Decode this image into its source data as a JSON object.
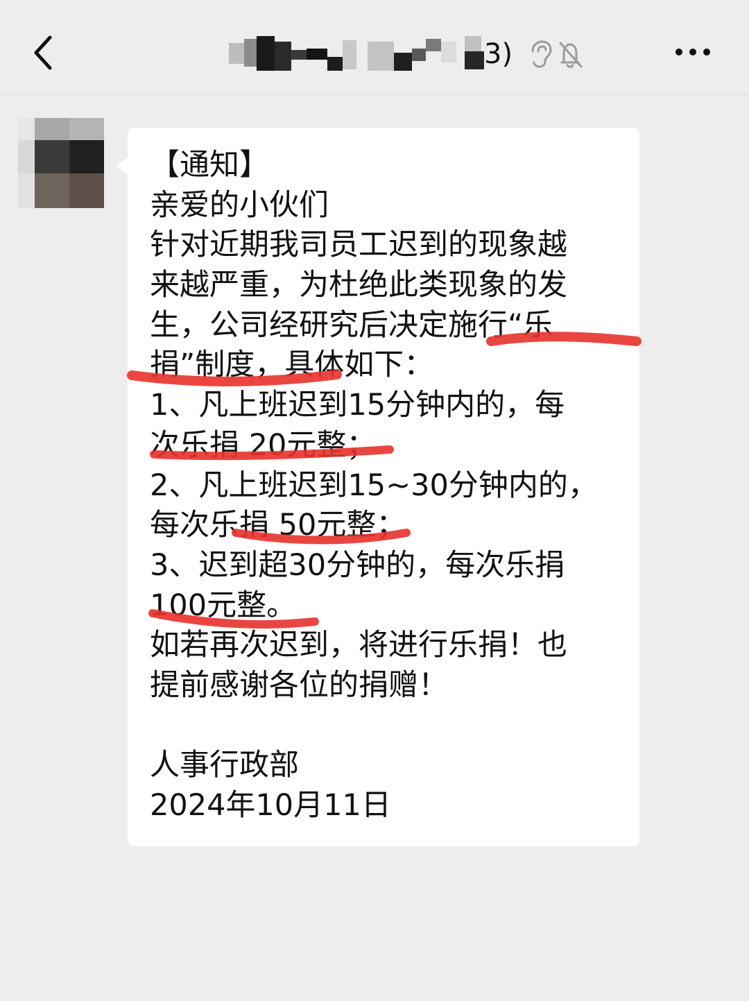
{
  "header": {
    "title_visible_suffix": "3)",
    "icons": [
      "back-icon",
      "ear-icon",
      "mute-bell-icon",
      "more-icon"
    ]
  },
  "message": {
    "lines": [
      "【通知】",
      "亲爱的小伙们",
      "针对近期我司员工迟到的现象越",
      "来越严重，为杜绝此类现象的发",
      "生，公司经研究后决定施行“乐",
      "捐”制度，具体如下：",
      "1、凡上班迟到15分钟内的，每",
      "次乐捐 20元整；",
      "2、凡上班迟到15~30分钟内的，",
      "每次乐捐 50元整；",
      "3、迟到超30分钟的，每次乐捐",
      "100元整。",
      "如若再次迟到，将进行乐捐！也",
      "提前感谢各位的捐赠！"
    ],
    "signature": "人事行政部",
    "date": "2024年10月11日"
  },
  "colors": {
    "background": "#ededed",
    "bubble": "#ffffff",
    "text": "#111111",
    "highlight": "#e8322c"
  }
}
